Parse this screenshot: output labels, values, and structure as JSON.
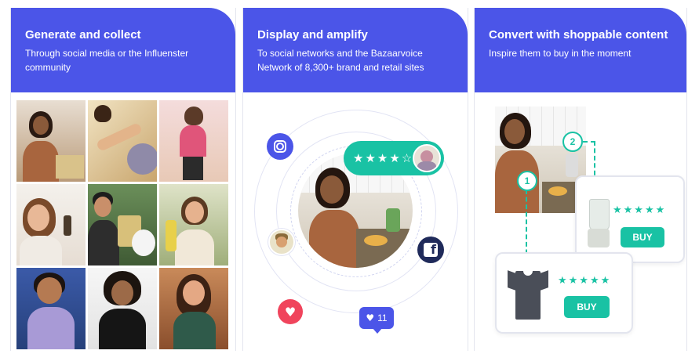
{
  "panels": [
    {
      "title": "Generate and collect",
      "subtitle": "Through social media or the Influenster community"
    },
    {
      "title": "Display and amplify",
      "subtitle": "To social networks and the Bazaarvoice Network of 8,300+ brand and retail sites"
    },
    {
      "title": "Convert with shoppable content",
      "subtitle": "Inspire them to buy in the moment"
    }
  ],
  "amplify": {
    "rating_stars": "★★★★☆",
    "like_count": "11",
    "icons": [
      "instagram-icon",
      "facebook-icon",
      "heart-icon",
      "like-badge-icon"
    ]
  },
  "shop": {
    "step_labels": [
      "1",
      "2"
    ],
    "stars": "★★★★★",
    "buy_label": "BUY"
  },
  "colors": {
    "brand_blue": "#4b55e8",
    "accent_teal": "#19c2a4",
    "facebook_navy": "#1f2a5a",
    "heart_red": "#f0445c"
  }
}
